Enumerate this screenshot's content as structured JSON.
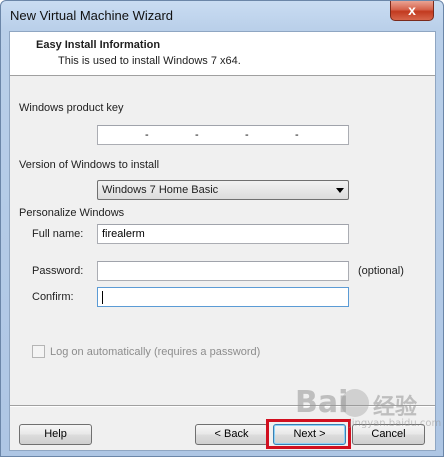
{
  "window": {
    "title": "New Virtual Machine Wizard",
    "close_glyph": "x"
  },
  "header": {
    "title": "Easy Install Information",
    "subtitle": "This is used to install Windows 7 x64."
  },
  "form": {
    "product_key_label": "Windows product key",
    "product_key_separators": [
      "-",
      "-",
      "-",
      "-"
    ],
    "version_label": "Version of Windows to install",
    "version_selected": "Windows 7 Home Basic",
    "personalize_label": "Personalize Windows",
    "full_name_label": "Full name:",
    "full_name_value": "firealerm",
    "password_label": "Password:",
    "password_hint": "(optional)",
    "confirm_label": "Confirm:",
    "autologon_label": "Log on automatically (requires a password)"
  },
  "buttons": {
    "help": "Help",
    "back": "< Back",
    "next": "Next >",
    "cancel": "Cancel"
  },
  "watermark": {
    "brand": "Bai",
    "cn": "经验",
    "url": "jingyan.baidu.com"
  },
  "colors": {
    "highlight": "#d10f1f",
    "close_button": "#c23a1f",
    "titlebar": "#b9cfe9"
  }
}
